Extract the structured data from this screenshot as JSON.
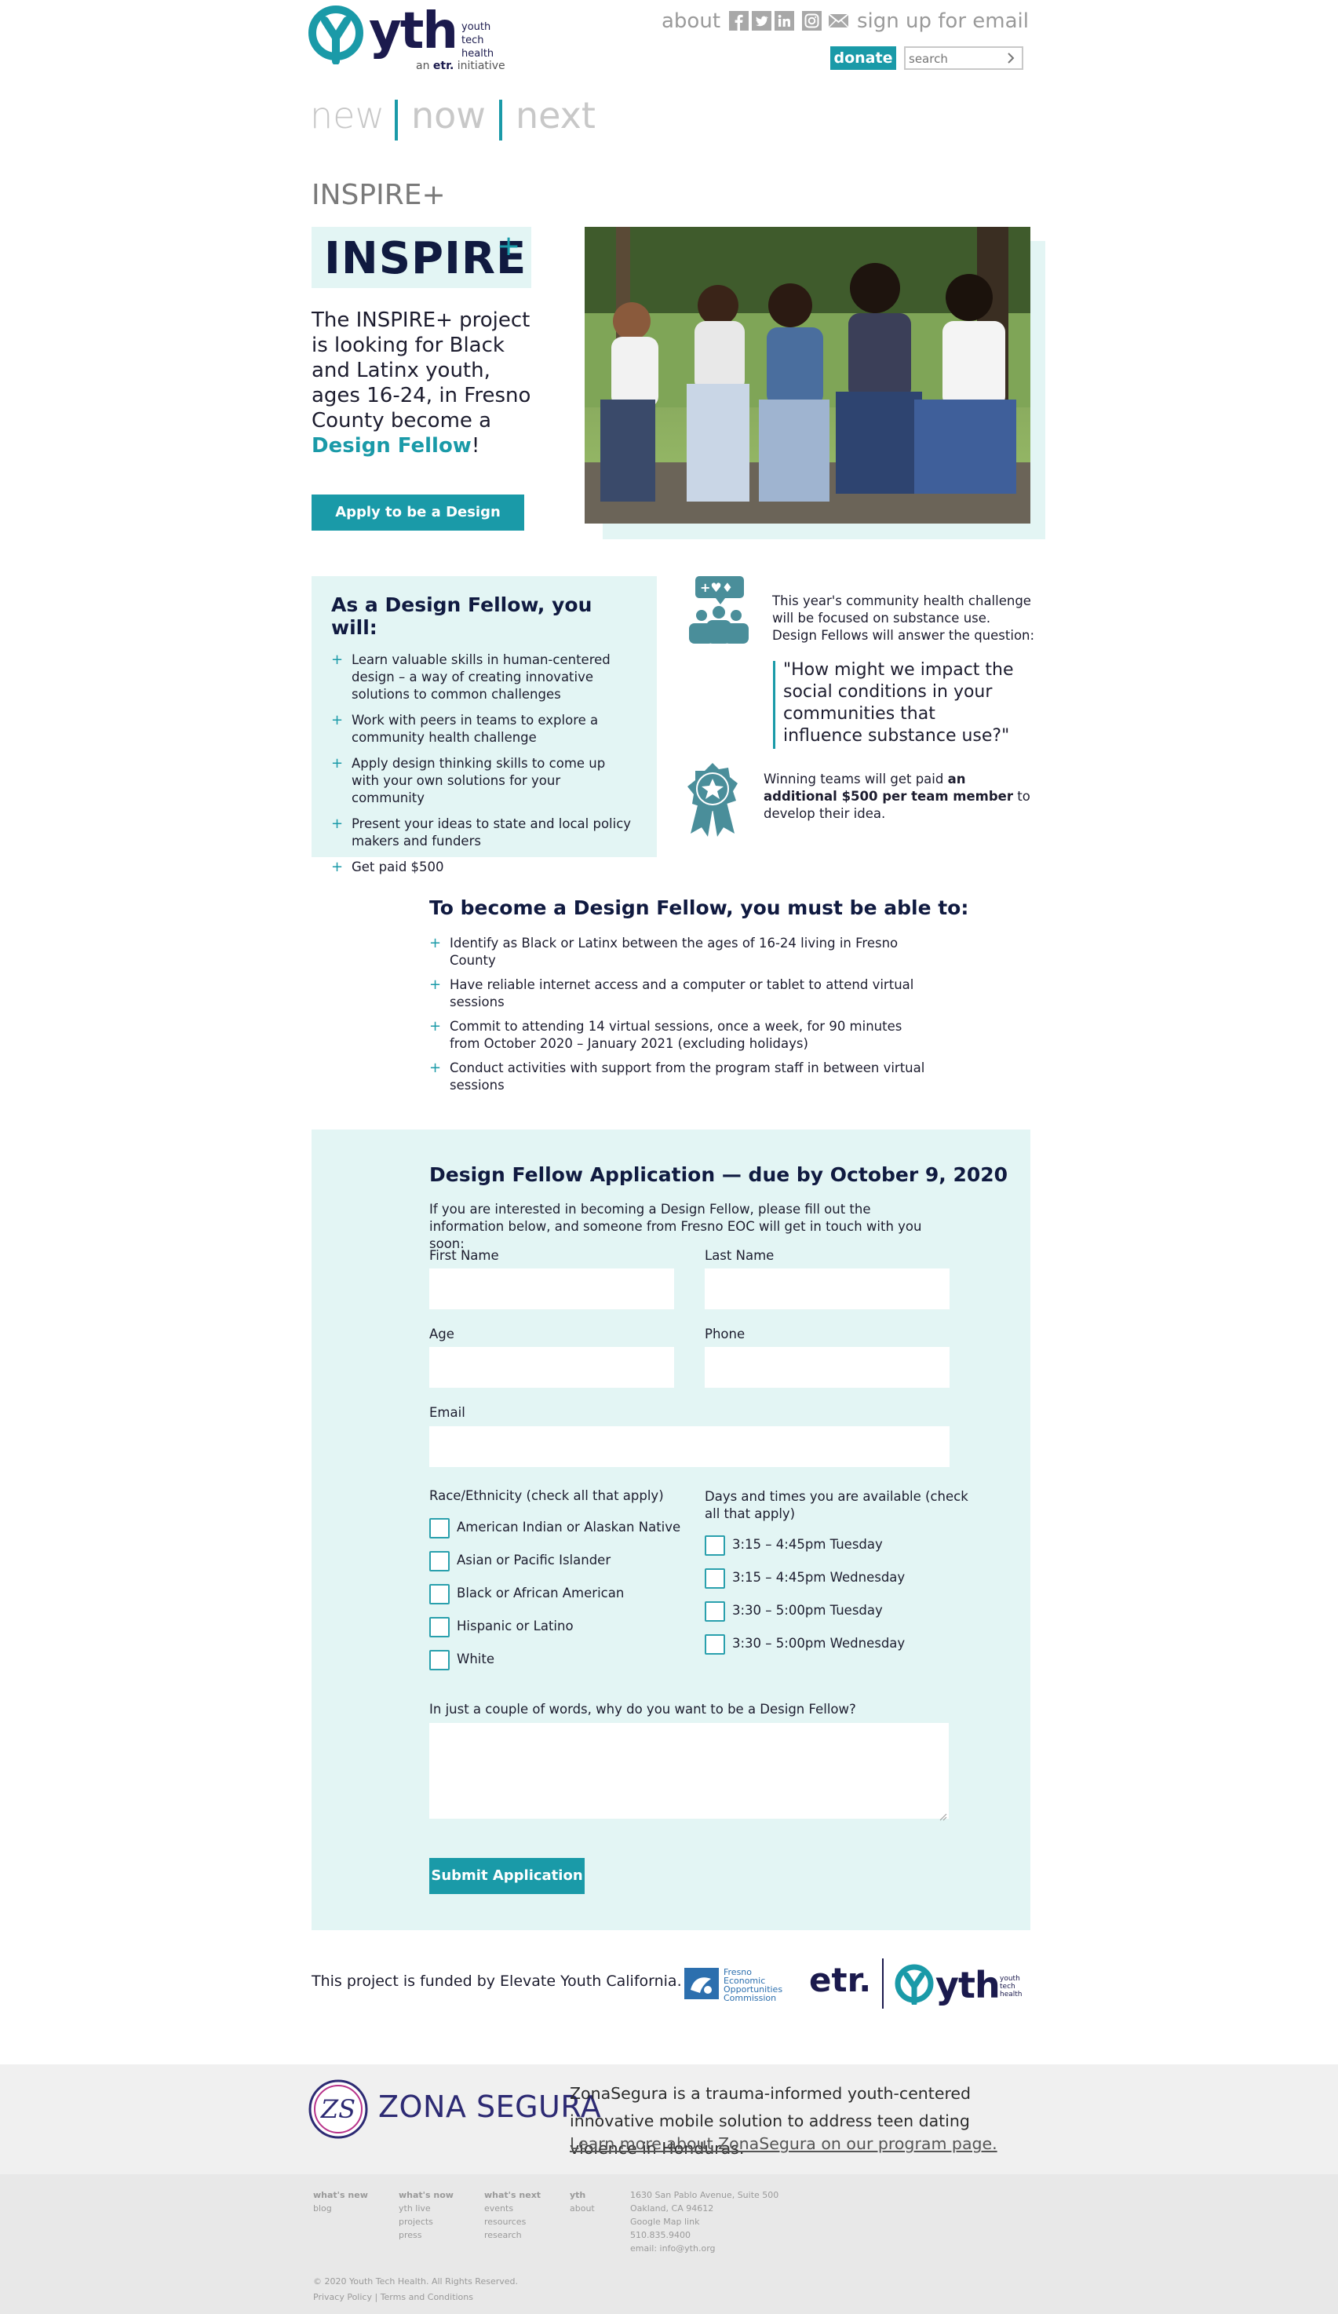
{
  "header": {
    "logo": {
      "word": "yth",
      "tagline_1": "youth",
      "tagline_2": "tech",
      "tagline_3": "health",
      "sub_prefix": "an",
      "sub_brand": "etr.",
      "sub_suffix": "initiative"
    },
    "nav_about": "about",
    "social_icons": [
      "facebook-icon",
      "twitter-icon",
      "linkedin-icon",
      "instagram-icon",
      "email-icon"
    ],
    "nav_signup": "sign up for email",
    "donate_label": "donate",
    "search_placeholder": "search",
    "taglines": [
      "new",
      "now",
      "next"
    ]
  },
  "page_title": "INSPIRE+",
  "hero": {
    "logo_text": "INSPIRE",
    "logo_plus": "+",
    "intro_text": "The INSPIRE+ project is looking for Black and Latinx youth, ages 16-24, in Fresno County become a ",
    "intro_highlight": "Design Fellow",
    "intro_end": "!",
    "apply_label": "Apply to be a Design Fellow"
  },
  "benefits": {
    "title": "As a Design Fellow, you will:",
    "items": [
      "Learn valuable skills in human-centered design – a way of creating innovative solutions to common challenges",
      "Work with peers in teams to explore a community health challenge",
      "Apply design thinking skills to come up with your own solutions for your community",
      "Present your ideas to state and local policy makers and funders",
      "Get paid $500"
    ]
  },
  "challenge": {
    "text": "This year's community health challenge will be focused on substance use. Design Fellows will answer the question:",
    "quote": "\"How might we impact the social conditions in your communities that influence substance use?\"",
    "award_prefix": "Winning teams will get paid ",
    "award_bold": "an additional $500 per team member",
    "award_suffix": " to develop their idea."
  },
  "requirements": {
    "title": "To become a Design Fellow, you must be able to:",
    "items": [
      "Identify as Black or Latinx between the ages of 16-24 living in Fresno County",
      "Have reliable internet access and a computer or tablet to attend virtual sessions",
      "Commit to attending 14 virtual sessions, once a week, for 90 minutes from October 2020 – January 2021 (excluding holidays)",
      "Conduct activities with support from the program staff in between virtual sessions"
    ]
  },
  "form": {
    "title": "Design Fellow Application — due by October 9, 2020",
    "intro": "If you are interested in becoming a Design Fellow, please fill out the information below, and someone from Fresno EOC will get in touch with you soon:",
    "first_name_label": "First Name",
    "last_name_label": "Last Name",
    "age_label": "Age",
    "phone_label": "Phone",
    "email_label": "Email",
    "race_label": "Race/Ethnicity (check all that apply)",
    "race_options": [
      "American Indian or Alaskan Native",
      "Asian or Pacific Islander",
      "Black or African American",
      "Hispanic or Latino",
      "White"
    ],
    "days_label": "Days and times you are available (check all that apply)",
    "day_options": [
      "3:15 – 4:45pm Tuesday",
      "3:15 – 4:45pm Wednesday",
      "3:30 – 5:00pm Tuesday",
      "3:30 – 5:00pm Wednesday"
    ],
    "why_label": "In just a couple of words, why do you want to be a Design Fellow?",
    "submit_label": "Submit Application"
  },
  "funders": {
    "text": "This project is funded by Elevate Youth California.",
    "fresno_lines": [
      "Fresno",
      "Economic",
      "Opportunities",
      "Commission"
    ],
    "etr": "etr.",
    "yth": "yth",
    "yth_tag": [
      "youth",
      "tech",
      "health"
    ]
  },
  "zona_segura": {
    "badge": "ZS",
    "name": "ZONA SEGURA",
    "description": "ZonaSegura is a trauma-informed youth-centered innovative mobile solution to address teen dating violence in Honduras.",
    "link": "Learn more about ZonaSegura on our program page."
  },
  "footer": {
    "columns": [
      {
        "heading": "what's new",
        "links": [
          "blog"
        ]
      },
      {
        "heading": "what's now",
        "links": [
          "yth live",
          "projects",
          "press"
        ]
      },
      {
        "heading": "what's next",
        "links": [
          "events",
          "resources",
          "research"
        ]
      },
      {
        "heading": "yth",
        "links": [
          "about"
        ]
      }
    ],
    "address": [
      "1630 San Pablo Avenue, Suite 500",
      "Oakland, CA 94612",
      "Google Map link",
      "510.835.9400",
      "email: info@yth.org"
    ],
    "copyright": "© 2020 Youth Tech Health. All Rights Reserved.",
    "privacy": "Privacy Policy",
    "legal_sep": "|",
    "terms": "Terms and Conditions"
  },
  "colors": {
    "teal": "#1a9aa8",
    "navy": "#101a40",
    "light_teal": "#e3f5f4",
    "zona_purple": "#2d2a73"
  }
}
